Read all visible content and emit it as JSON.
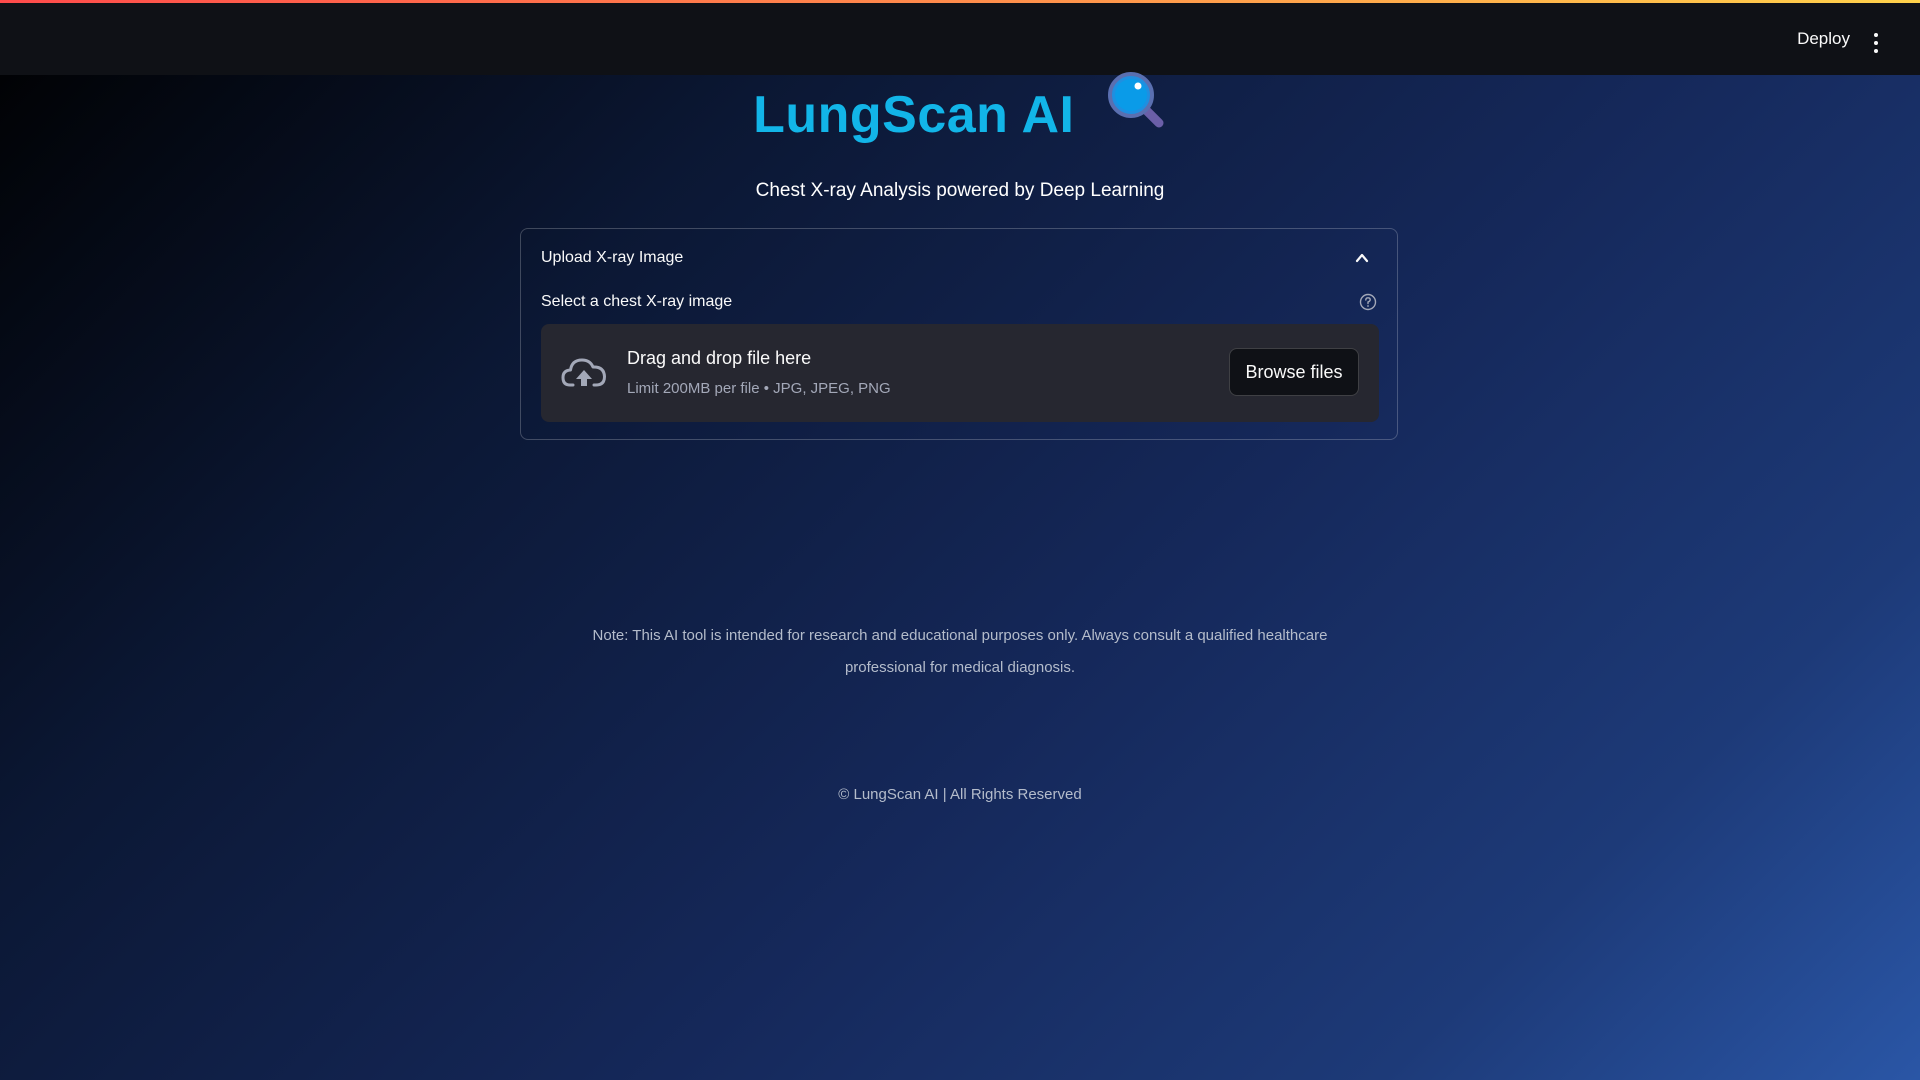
{
  "header": {
    "deploy_label": "Deploy",
    "menu_icon": "vertical-ellipsis-icon"
  },
  "hero": {
    "title": "LungScan AI",
    "title_icon": "magnifying-glass-icon",
    "subtitle": "Chest X-ray Analysis powered by Deep Learning"
  },
  "upload": {
    "expander_label": "Upload X-ray Image",
    "expander_icon": "chevron-up-icon",
    "field_label": "Select a chest X-ray image",
    "help_icon": "help-circle-icon",
    "dropzone_title": "Drag and drop file here",
    "dropzone_subtitle": "Limit 200MB per file • JPG, JPEG, PNG",
    "dropzone_icon": "cloud-upload-icon",
    "browse_label": "Browse files"
  },
  "note": "Note: This AI tool is intended for research and educational purposes only. Always consult a qualified healthcare professional for medical diagnosis.",
  "footer": "© LungScan AI | All Rights Reserved",
  "colors": {
    "title": "#12b5e8",
    "topbar": "#0f1116",
    "dropzone": "#262730"
  }
}
